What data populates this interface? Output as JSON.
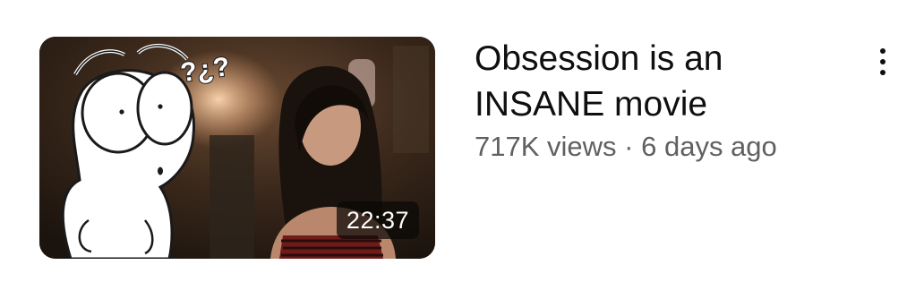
{
  "video": {
    "title": "Obsession is an INSANE movie",
    "views": "717K views",
    "separator": "·",
    "age": "6 days ago",
    "duration": "22:37"
  },
  "thumbnail": {
    "overlay_text": "?¿?",
    "colors": {
      "background": "#2a1d14",
      "accent": "#e8b48a"
    }
  },
  "icons": {
    "menu": "more-vert-icon"
  }
}
